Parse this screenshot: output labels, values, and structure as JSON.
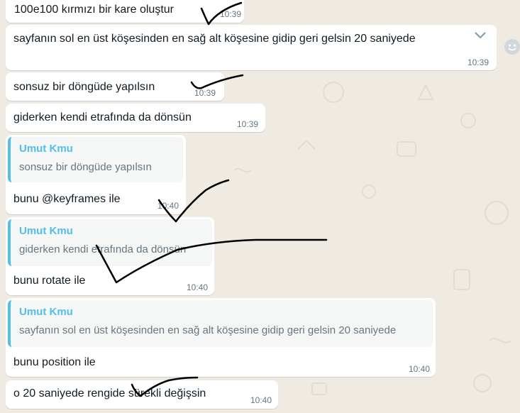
{
  "messages": [
    {
      "text": "100e100 kırmızı bir kare oluştur",
      "time": "10:39"
    },
    {
      "text": "sayfanın sol en üst köşesinden en sağ alt köşesine gidip geri gelsin 20 saniyede",
      "time": "10:39"
    },
    {
      "text": "sonsuz bir döngüde yapılsın",
      "time": "10:39"
    },
    {
      "text": "giderken kendi etrafında da dönsün",
      "time": "10:39"
    },
    {
      "quote_author": "Umut Kmu",
      "quote_text": "sonsuz bir döngüde yapılsın",
      "text": "bunu @keyframes ile",
      "time": "10:40"
    },
    {
      "quote_author": "Umut Kmu",
      "quote_text": "giderken kendi etrafında da dönsün",
      "text": "bunu rotate ile",
      "time": "10:40"
    },
    {
      "quote_author": "Umut Kmu",
      "quote_text": "sayfanın sol en üst köşesinden en sağ alt köşesine gidip geri gelsin 20 saniyede",
      "text": "bunu position ile",
      "time": "10:40"
    },
    {
      "text": "o 20 saniyede rengide sürekli değişsin",
      "time": "10:40"
    }
  ],
  "icons": {
    "menu_chevron": "chevron-down-icon",
    "emoji_reaction": "smiley-icon"
  },
  "colors": {
    "background": "#efeae2",
    "bubble": "#ffffff",
    "quote_accent": "#53bdeb",
    "timestamp": "#667781",
    "ink": "#000000"
  }
}
